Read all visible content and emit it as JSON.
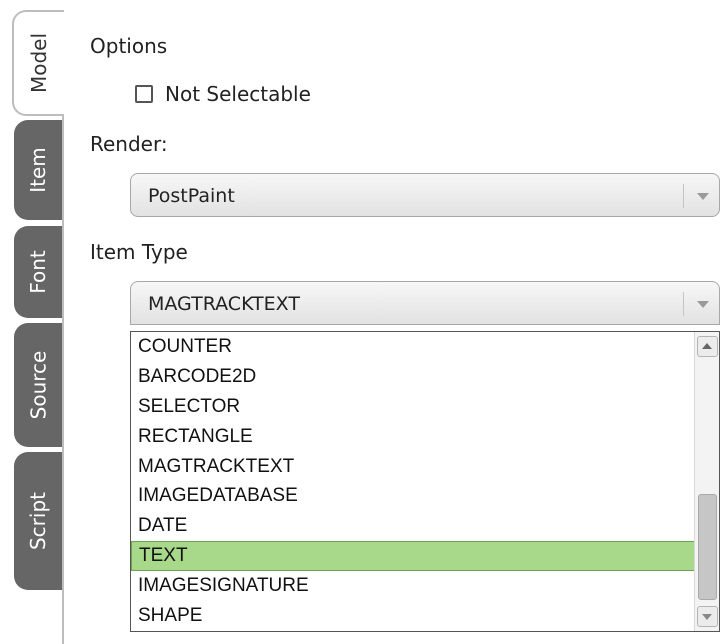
{
  "tabs": [
    {
      "label": "Model",
      "active": true
    },
    {
      "label": "Item",
      "active": false
    },
    {
      "label": "Font",
      "active": false
    },
    {
      "label": "Source",
      "active": false
    },
    {
      "label": "Script",
      "active": false
    }
  ],
  "options": {
    "heading": "Options",
    "not_selectable_label": "Not Selectable",
    "not_selectable_checked": false
  },
  "render": {
    "label": "Render:",
    "value": "PostPaint"
  },
  "item_type": {
    "label": "Item Type",
    "value": "MAGTRACKTEXT",
    "options": [
      "COUNTER",
      "BARCODE2D",
      "SELECTOR",
      "RECTANGLE",
      "MAGTRACKTEXT",
      "IMAGEDATABASE",
      "DATE",
      "TEXT",
      "IMAGESIGNATURE",
      "SHAPE"
    ],
    "highlighted": "TEXT",
    "highlight_color": "#a8d88a"
  }
}
